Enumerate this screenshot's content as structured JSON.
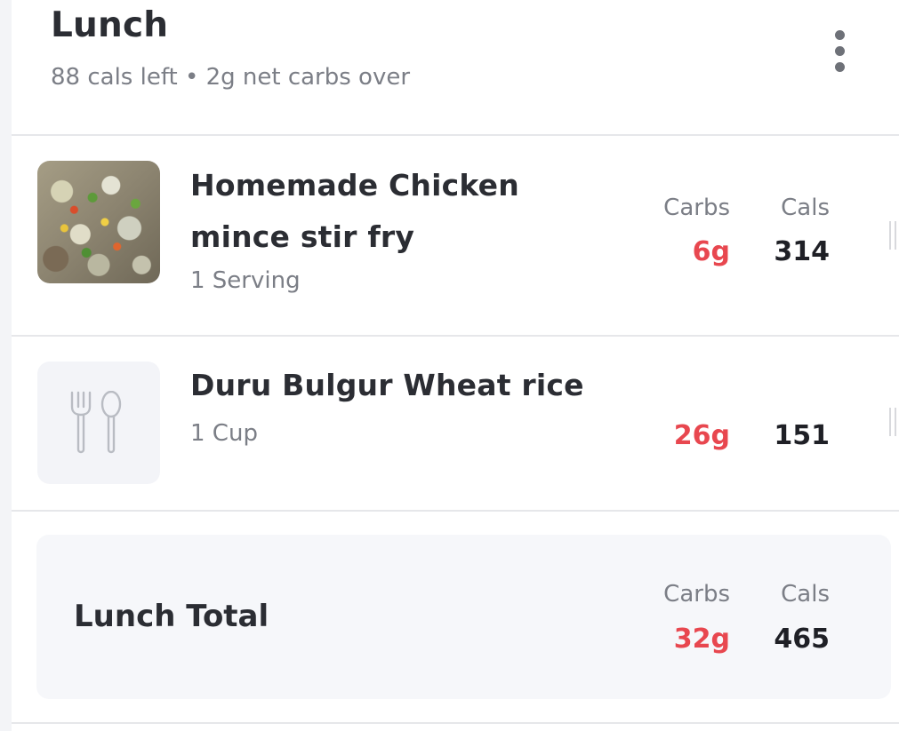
{
  "meal": {
    "title": "Lunch",
    "subtitle": "88 cals left • 2g net carbs over",
    "more_icon": "more-vertical-icon"
  },
  "columns": {
    "carbs": "Carbs",
    "cals": "Cals"
  },
  "items": [
    {
      "name_line1": "Homemade Chicken",
      "name_line2": "mince stir fry",
      "serving": "1 Serving",
      "carbs": "6g",
      "cals": "314",
      "image": "food-photo"
    },
    {
      "name_line1": "Duru Bulgur Wheat rice",
      "serving": "1 Cup",
      "carbs": "26g",
      "cals": "151",
      "image": "fork-spoon-icon"
    }
  ],
  "total": {
    "label": "Lunch Total",
    "carbs": "32g",
    "cals": "465"
  },
  "colors": {
    "carbs": "#e8474f",
    "text": "#2b2d33",
    "muted": "#7b7e86"
  }
}
